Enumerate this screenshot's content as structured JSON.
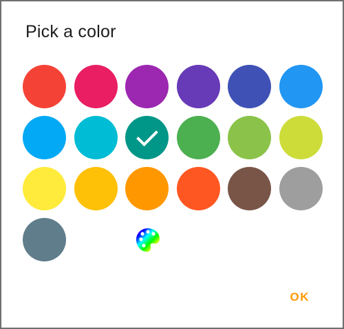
{
  "dialog": {
    "title": "Pick a color",
    "ok_label": "OK"
  },
  "swatches": [
    {
      "name": "red",
      "color": "#f44336",
      "selected": false
    },
    {
      "name": "pink",
      "color": "#e91e63",
      "selected": false
    },
    {
      "name": "purple",
      "color": "#9c27b0",
      "selected": false
    },
    {
      "name": "deep-purple",
      "color": "#673ab7",
      "selected": false
    },
    {
      "name": "indigo",
      "color": "#3f51b5",
      "selected": false
    },
    {
      "name": "blue",
      "color": "#2196f3",
      "selected": false
    },
    {
      "name": "light-blue",
      "color": "#03a9f4",
      "selected": false
    },
    {
      "name": "cyan",
      "color": "#00bcd4",
      "selected": false
    },
    {
      "name": "teal",
      "color": "#009688",
      "selected": true
    },
    {
      "name": "green",
      "color": "#4caf50",
      "selected": false
    },
    {
      "name": "light-green",
      "color": "#8bc34a",
      "selected": false
    },
    {
      "name": "lime",
      "color": "#cddc39",
      "selected": false
    },
    {
      "name": "yellow",
      "color": "#ffeb3b",
      "selected": false
    },
    {
      "name": "amber",
      "color": "#ffc107",
      "selected": false
    },
    {
      "name": "orange",
      "color": "#ff9800",
      "selected": false
    },
    {
      "name": "deep-orange",
      "color": "#ff5722",
      "selected": false
    },
    {
      "name": "brown",
      "color": "#795548",
      "selected": false
    },
    {
      "name": "grey",
      "color": "#9e9e9e",
      "selected": false
    },
    {
      "name": "blue-grey",
      "color": "#607d8b",
      "selected": false
    }
  ],
  "custom_palette": {
    "icon": "palette-icon"
  },
  "colors": {
    "accent": "#ff9800",
    "check": "#ffffff"
  }
}
